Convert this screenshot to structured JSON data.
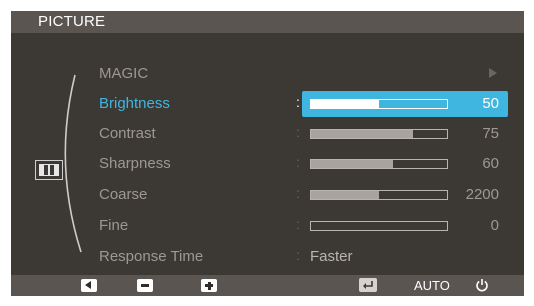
{
  "window": {
    "title": "PICTURE"
  },
  "menu_icon": "picture-menu-icon",
  "items": [
    {
      "label": "MAGIC",
      "kind": "submenu",
      "selected": false
    },
    {
      "label": "Brightness",
      "kind": "slider",
      "value": 50,
      "level": 0.5,
      "selected": true
    },
    {
      "label": "Contrast",
      "kind": "slider",
      "value": 75,
      "level": 0.75,
      "selected": false
    },
    {
      "label": "Sharpness",
      "kind": "slider",
      "value": 60,
      "level": 0.6,
      "selected": false
    },
    {
      "label": "Coarse",
      "kind": "slider",
      "value": 2200,
      "level": 0.5,
      "selected": false
    },
    {
      "label": "Fine",
      "kind": "slider",
      "value": 0,
      "level": 0.0,
      "selected": false
    },
    {
      "label": "Response Time",
      "kind": "option",
      "value": "Faster",
      "selected": false
    }
  ],
  "colon": ":",
  "bottom_bar": {
    "buttons": [
      {
        "name": "left-arrow-icon"
      },
      {
        "name": "minus-icon"
      },
      {
        "name": "plus-icon"
      },
      {
        "name": "enter-icon"
      },
      {
        "name": "auto-button",
        "label": "AUTO"
      },
      {
        "name": "power-icon"
      }
    ],
    "auto_label": "AUTO"
  },
  "colors": {
    "background": "#3c3834",
    "bar": "#5a5550",
    "highlight": "#3fb6e0",
    "text": "#9d9893",
    "active_text": "#ffffff"
  }
}
